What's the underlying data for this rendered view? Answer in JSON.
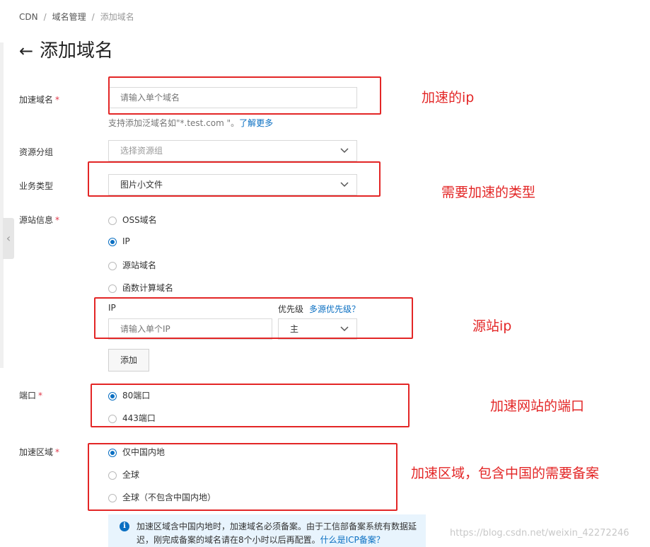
{
  "breadcrumb": {
    "item1": "CDN",
    "item2": "域名管理",
    "current": "添加域名",
    "sep": "/"
  },
  "header": {
    "back_icon": "←",
    "title": "添加域名"
  },
  "form": {
    "domain": {
      "label": "加速域名",
      "required": "*",
      "placeholder": "请输入单个域名",
      "hint": "支持添加泛域名如\"*.test.com \"。",
      "hint_link": "了解更多"
    },
    "resource_group": {
      "label": "资源分组",
      "placeholder": "选择资源组"
    },
    "business_type": {
      "label": "业务类型",
      "value": "图片小文件"
    },
    "origin": {
      "label": "源站信息",
      "required": "*",
      "options": [
        "OSS域名",
        "IP",
        "源站域名",
        "函数计算域名"
      ],
      "selected": "IP",
      "ip_label": "IP",
      "priority_label": "优先级",
      "priority_link": "多源优先级？",
      "ip_placeholder": "请输入单个IP",
      "priority_value": "主",
      "add_button": "添加"
    },
    "port": {
      "label": "端口",
      "required": "*",
      "options": [
        "80端口",
        "443端口"
      ],
      "selected": "80端口"
    },
    "region": {
      "label": "加速区域",
      "required": "*",
      "options": [
        "仅中国内地",
        "全球",
        "全球（不包含中国内地）"
      ],
      "selected": "仅中国内地"
    },
    "notice": {
      "text": "加速区域含中国内地时，加速域名必须备案。由于工信部备案系统有数据延迟，刚完成备案的域名请在8个小时以后再配置。",
      "link": "什么是ICP备案？"
    }
  },
  "annotations": {
    "a1": "加速的ip",
    "a2": "需要加速的类型",
    "a3": "源站ip",
    "a4": "加速网站的端口",
    "a5": "加速区域，包含中国的需要备案"
  },
  "watermark": "https://blog.csdn.net/weixin_42272246",
  "colors": {
    "accent": "#0a6fc2",
    "annotation": "#e32626",
    "required": "#e0384a",
    "notice_bg": "#e8f4fd"
  }
}
